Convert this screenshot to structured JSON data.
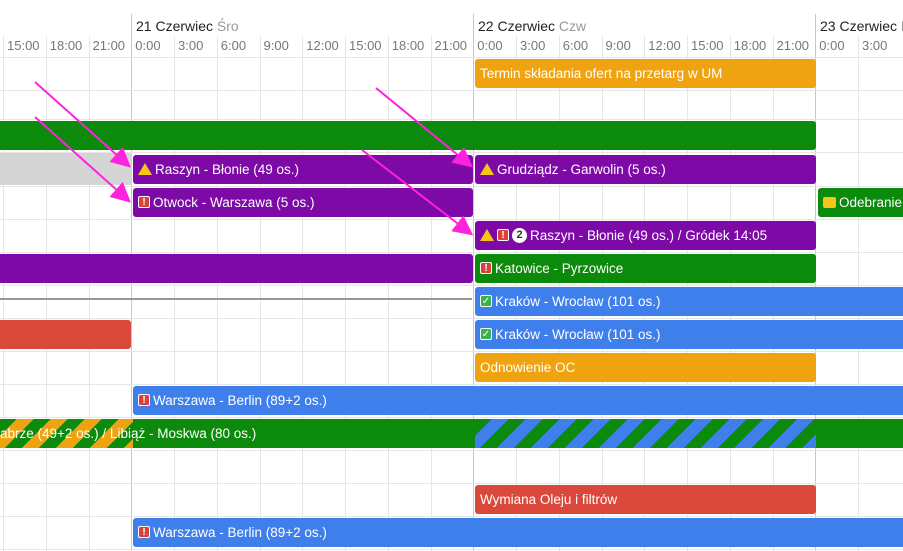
{
  "days": [
    {
      "label": "21 Czerwiec",
      "dow": "Śro"
    },
    {
      "label": "22 Czerwiec",
      "dow": "Czw"
    },
    {
      "label": "23 Czerwiec",
      "dow": "P"
    }
  ],
  "hours": [
    "15:00",
    "18:00",
    "21:00",
    "0:00",
    "3:00",
    "6:00",
    "9:00",
    "12:00",
    "15:00",
    "18:00",
    "21:00",
    "0:00",
    "3:00",
    "6:00",
    "9:00",
    "12:00",
    "15:00",
    "18:00",
    "21:00",
    "0:00",
    "3:00"
  ],
  "events": [
    {
      "name": "event-termin-skladania",
      "label": "Termin składania ofert na przetarg w UM",
      "color": "#f0a311",
      "icons": []
    },
    {
      "name": "event-green-long",
      "label": "",
      "color": "#0b8a0b",
      "icons": []
    },
    {
      "name": "event-raszyn-blonie",
      "label": "Raszyn - Błonie (49 os.)",
      "color": "#7d0aa6",
      "icons": [
        "warn"
      ]
    },
    {
      "name": "event-grudziadz-garwolin",
      "label": "Grudziądz - Garwolin (5 os.)",
      "color": "#7d0aa6",
      "icons": [
        "warn"
      ]
    },
    {
      "name": "event-otwock-warszawa",
      "label": "Otwock - Warszawa (5 os.)",
      "color": "#7d0aa6",
      "icons": [
        "alert"
      ]
    },
    {
      "name": "event-odebranie",
      "label": "Odebranie",
      "color": "#0b8a0b",
      "icons": [
        "note"
      ]
    },
    {
      "name": "event-raszyn-grodek",
      "label": "Raszyn - Błonie (49 os.) / Gródek 14:05",
      "color": "#7d0aa6",
      "icons": [
        "warn",
        "alert"
      ],
      "badge": "2"
    },
    {
      "name": "event-purple-left",
      "label": "",
      "color": "#7d0aa6",
      "icons": []
    },
    {
      "name": "event-katowice-pyrzowice",
      "label": "Katowice - Pyrzowice",
      "color": "#0b8a0b",
      "icons": [
        "alert"
      ]
    },
    {
      "name": "event-krakow-wroclaw-1",
      "label": "Kraków - Wrocław (101 os.)",
      "color": "#3f7fec",
      "icons": [
        "ok"
      ]
    },
    {
      "name": "event-red-left",
      "label": "",
      "color": "#d9483b",
      "icons": []
    },
    {
      "name": "event-krakow-wroclaw-2",
      "label": "Kraków - Wrocław (101 os.)",
      "color": "#3f7fec",
      "icons": [
        "ok"
      ]
    },
    {
      "name": "event-odnowienie-oc",
      "label": "Odnowienie OC",
      "color": "#f0a311",
      "icons": []
    },
    {
      "name": "event-warszawa-berlin-1",
      "label": "Warszawa - Berlin (89+2 os.)",
      "color": "#3f7fec",
      "icons": [
        "alert"
      ]
    },
    {
      "name": "event-striped-moskwa",
      "label": "abrze (49+2 os.) / Libiąż - Moskwa (80 os.)",
      "color": "#0b8a0b",
      "icons": []
    },
    {
      "name": "event-wymiana-oleju",
      "label": "Wymiana Oleju i filtrów",
      "color": "#d9483b",
      "icons": []
    },
    {
      "name": "event-warszawa-berlin-2",
      "label": "Warszawa - Berlin (89+2 os.)",
      "color": "#3f7fec",
      "icons": [
        "alert"
      ]
    }
  ],
  "colors": {
    "arrow": "#ff22dd",
    "grid": "#e6e6e6"
  }
}
